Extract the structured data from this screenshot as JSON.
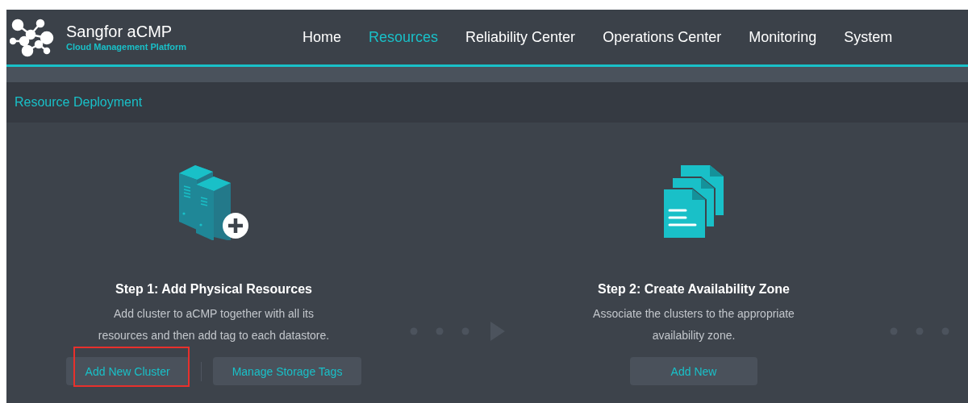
{
  "header": {
    "product": "Sangfor aCMP",
    "subtitle": "Cloud Management Platform"
  },
  "nav": [
    {
      "label": "Home",
      "selected": false
    },
    {
      "label": "Resources",
      "selected": true
    },
    {
      "label": "Reliability Center",
      "selected": false
    },
    {
      "label": "Operations Center",
      "selected": false
    },
    {
      "label": "Monitoring",
      "selected": false
    },
    {
      "label": "System",
      "selected": false
    }
  ],
  "section_title": "Resource Deployment",
  "steps": [
    {
      "kind": "servers",
      "title": "Step 1: Add Physical Resources",
      "description": "Add cluster to aCMP together with all its resources and then add tag to each datastore.",
      "buttons": [
        {
          "label": "Add New Cluster",
          "highlighted": true
        },
        {
          "label": "Manage Storage Tags",
          "highlighted": false
        }
      ]
    },
    {
      "kind": "documents",
      "title": "Step 2: Create Availability Zone",
      "description": "Associate the clusters to the appropriate availability zone.",
      "buttons": [
        {
          "label": "Add New",
          "highlighted": false
        }
      ]
    }
  ]
}
